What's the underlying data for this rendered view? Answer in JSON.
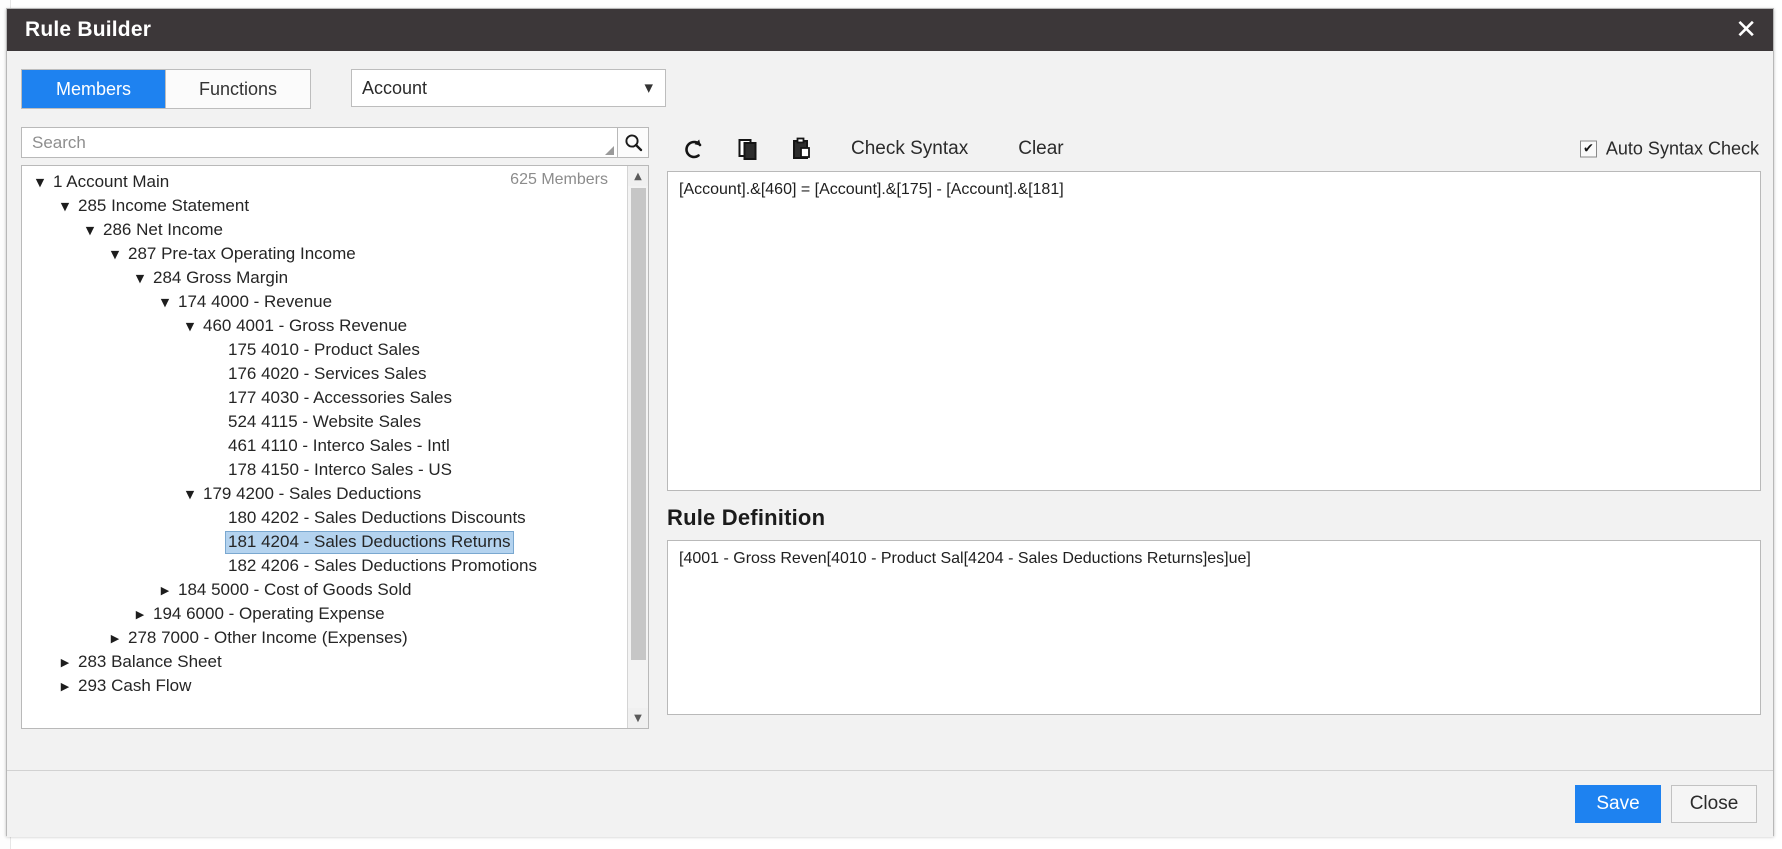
{
  "window": {
    "title": "Rule Builder",
    "close_icon": "close-icon"
  },
  "toolbar_top": {
    "tabs": [
      {
        "label": "Members",
        "active": true
      },
      {
        "label": "Functions",
        "active": false
      }
    ],
    "dimension_select": {
      "value": "Account",
      "caret": "▼"
    }
  },
  "search": {
    "placeholder": "Search",
    "value": "",
    "icon": "search-icon"
  },
  "tree": {
    "members_count": "625 Members",
    "scroll_up": "▲",
    "scroll_down": "▼",
    "expanded_glyph": "▼",
    "collapsed_glyph": "▶",
    "rows": [
      {
        "label": "1 Account Main",
        "depth": 0,
        "state": "expanded",
        "selected": false
      },
      {
        "label": "285 Income Statement",
        "depth": 1,
        "state": "expanded",
        "selected": false
      },
      {
        "label": "286 Net Income",
        "depth": 2,
        "state": "expanded",
        "selected": false
      },
      {
        "label": "287 Pre-tax Operating Income",
        "depth": 3,
        "state": "expanded",
        "selected": false
      },
      {
        "label": "284 Gross Margin",
        "depth": 4,
        "state": "expanded",
        "selected": false
      },
      {
        "label": "174 4000 - Revenue",
        "depth": 5,
        "state": "expanded",
        "selected": false
      },
      {
        "label": "460 4001 - Gross Revenue",
        "depth": 6,
        "state": "expanded",
        "selected": false
      },
      {
        "label": "175 4010 - Product Sales",
        "depth": 7,
        "state": "leaf",
        "selected": false
      },
      {
        "label": "176 4020 - Services Sales",
        "depth": 7,
        "state": "leaf",
        "selected": false
      },
      {
        "label": "177 4030 - Accessories Sales",
        "depth": 7,
        "state": "leaf",
        "selected": false
      },
      {
        "label": "524 4115 - Website Sales",
        "depth": 7,
        "state": "leaf",
        "selected": false
      },
      {
        "label": "461 4110 - Interco Sales - Intl",
        "depth": 7,
        "state": "leaf",
        "selected": false
      },
      {
        "label": "178 4150 - Interco Sales - US",
        "depth": 7,
        "state": "leaf",
        "selected": false
      },
      {
        "label": "179 4200 - Sales Deductions",
        "depth": 6,
        "state": "expanded",
        "selected": false
      },
      {
        "label": "180 4202 - Sales Deductions Discounts",
        "depth": 7,
        "state": "leaf",
        "selected": false
      },
      {
        "label": "181 4204 - Sales Deductions Returns",
        "depth": 7,
        "state": "leaf",
        "selected": true
      },
      {
        "label": "182 4206 - Sales Deductions Promotions",
        "depth": 7,
        "state": "leaf",
        "selected": false
      },
      {
        "label": "184 5000 - Cost of Goods Sold",
        "depth": 5,
        "state": "collapsed",
        "selected": false
      },
      {
        "label": "194 6000 - Operating Expense",
        "depth": 4,
        "state": "collapsed",
        "selected": false
      },
      {
        "label": "278 7000 - Other Income (Expenses)",
        "depth": 3,
        "state": "collapsed",
        "selected": false
      },
      {
        "label": "283 Balance Sheet",
        "depth": 1,
        "state": "collapsed",
        "selected": false
      },
      {
        "label": "293 Cash Flow",
        "depth": 1,
        "state": "collapsed",
        "selected": false
      }
    ]
  },
  "editor": {
    "toolbar": {
      "undo_icon": "undo-icon",
      "copy_icon": "copy-icon",
      "paste_icon": "paste-icon",
      "check_syntax_label": "Check Syntax",
      "clear_label": "Clear",
      "auto_syntax_check_label": "Auto Syntax Check",
      "auto_syntax_check_checked": true,
      "checkmark": "✔"
    },
    "formula": "[Account].&[460] = [Account].&[175] - [Account].&[181]",
    "rule_definition_title": "Rule Definition",
    "rule_definition": "[4001 - Gross Reven[4010 - Product Sal[4204 - Sales Deductions Returns]es]ue]"
  },
  "footer": {
    "save_label": "Save",
    "close_label": "Close"
  },
  "colors": {
    "accent": "#1e82f0",
    "titlebar": "#3c3739",
    "selection": "#b4d3ef",
    "dialog_bg": "#f2f2f2"
  }
}
